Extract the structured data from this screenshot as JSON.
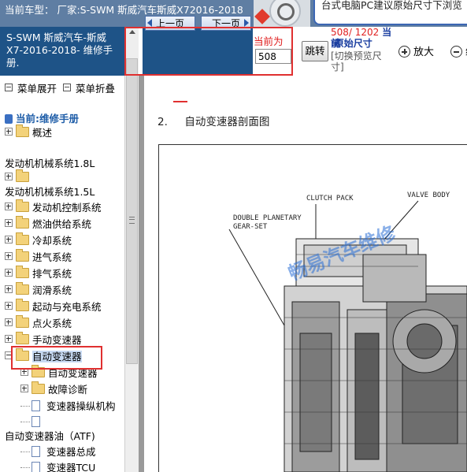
{
  "header": {
    "car_info": "当前车型：  厂家:S-SWM 斯威汽车斯威X72016-2018",
    "notice": "台式电脑PC建议原始尺寸下浏览"
  },
  "left_panel": {
    "manual_title": "S-SWM 斯威汽车-斯威X7-2016-2018- 维修手册.",
    "expand_label": "菜单展开",
    "collapse_label": "菜单折叠"
  },
  "tree": {
    "root_label": "当前:维修手册",
    "items": [
      {
        "label": "概述"
      },
      {
        "label": "发动机机械系统1.8L"
      },
      {
        "label": "发动机机械系统1.5L"
      },
      {
        "label": "发动机控制系统"
      },
      {
        "label": "燃油供给系统"
      },
      {
        "label": "冷却系统"
      },
      {
        "label": "进气系统"
      },
      {
        "label": "排气系统"
      },
      {
        "label": "润滑系统"
      },
      {
        "label": "起动与充电系统"
      },
      {
        "label": "点火系统"
      },
      {
        "label": "手动变速器"
      },
      {
        "label": "自动变速器",
        "selected": true
      },
      {
        "label": "自动变速器"
      },
      {
        "label": "故障诊断"
      },
      {
        "label": "变速器操纵机构"
      },
      {
        "label": "自动变速器油（ATF)"
      },
      {
        "label": "变速器总成"
      },
      {
        "label": "变速器TCU"
      }
    ]
  },
  "toolbar": {
    "prev_label": "上一页",
    "next_label": "下一页",
    "current_label": "当前为",
    "page_value": "508",
    "jump_label": "跳转",
    "page_count": "508/ 1202",
    "page_current_suffix": "当前",
    "orig_size": ":原始尺寸",
    "switch_hint": "[切换预览尺寸]",
    "zoom_in": "放大",
    "zoom_out": "缩"
  },
  "document": {
    "section_number": "2.",
    "section_title": "自动变速器剖面图",
    "labels": {
      "clutch_pack": "CLUTCH PACK",
      "valve_body": "VALVE BODY",
      "double_planetary": "DOUBLE PLANETARY",
      "gear_set": "GEAR-SET"
    },
    "watermark": "畅易汽车维修"
  },
  "colors": {
    "header_bg": "#5f7ea3",
    "panel_blue": "#1e5387",
    "highlight_red": "#e03030",
    "selected_bg": "#c7d9f2"
  }
}
